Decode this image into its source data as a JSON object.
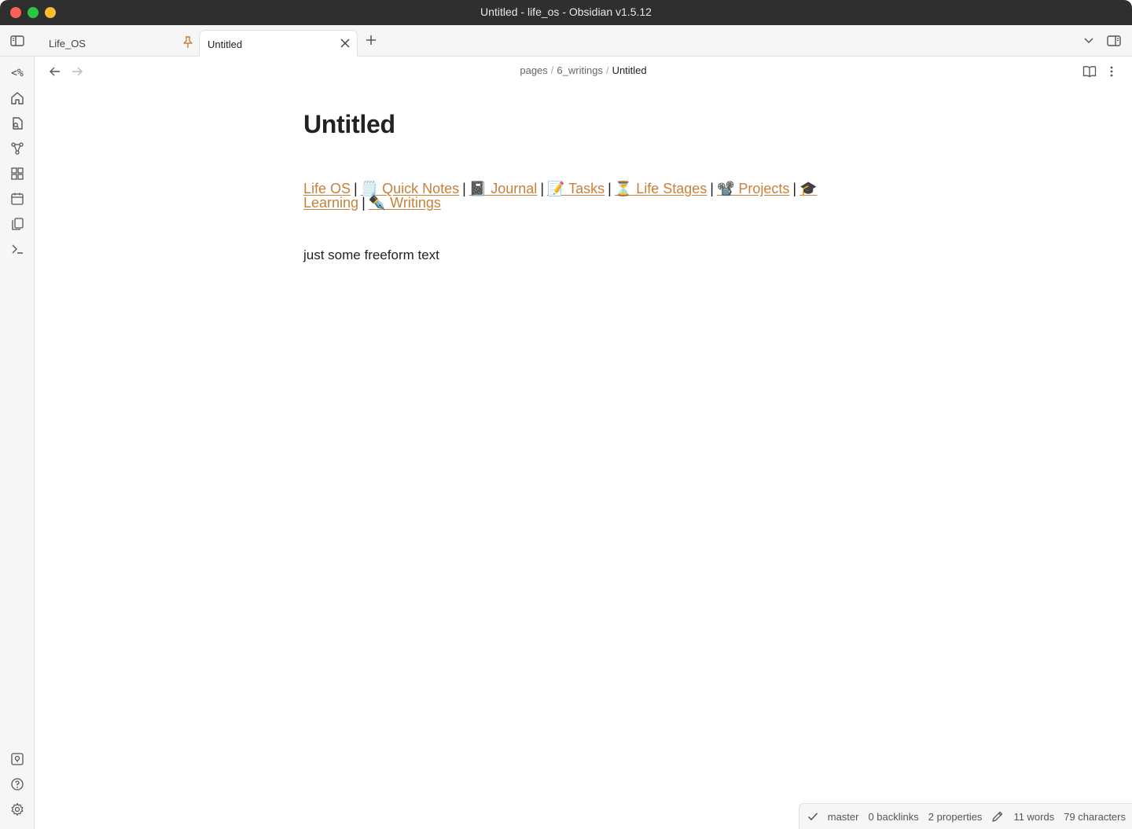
{
  "window": {
    "title": "Untitled - life_os - Obsidian v1.5.12"
  },
  "tabs": [
    {
      "label": "Life_OS",
      "pinned": true
    },
    {
      "label": "Untitled",
      "active": true
    }
  ],
  "ribbon": {
    "templater_label": "<%",
    "items": [
      "templater-icon",
      "home-icon",
      "file-search-icon",
      "graph-icon",
      "dashboard-icon",
      "calendar-icon",
      "copy-icon",
      "terminal-icon"
    ],
    "bottom_items": [
      "vault-icon",
      "help-icon",
      "settings-icon"
    ]
  },
  "breadcrumb": {
    "parts": [
      "pages",
      "6_writings"
    ],
    "separator": "/",
    "current": "Untitled"
  },
  "document": {
    "title": "Untitled",
    "links": [
      {
        "text": "Life OS"
      },
      {
        "text": "🗒️ Quick Notes"
      },
      {
        "text": "📓 Journal"
      },
      {
        "text": "📝 Tasks"
      },
      {
        "text": "⏳ Life Stages"
      },
      {
        "text": "📽️ Projects"
      },
      {
        "text": "🎓 Learning"
      },
      {
        "text": "✒️ Writings"
      }
    ],
    "link_separator": "|",
    "body": "just some freeform text"
  },
  "status": {
    "branch": "master",
    "backlinks": "0 backlinks",
    "properties": "2 properties",
    "words": "11 words",
    "characters": "79 characters"
  },
  "colors": {
    "accent": "#c7813b",
    "titlebar": "#2f2f2f"
  }
}
